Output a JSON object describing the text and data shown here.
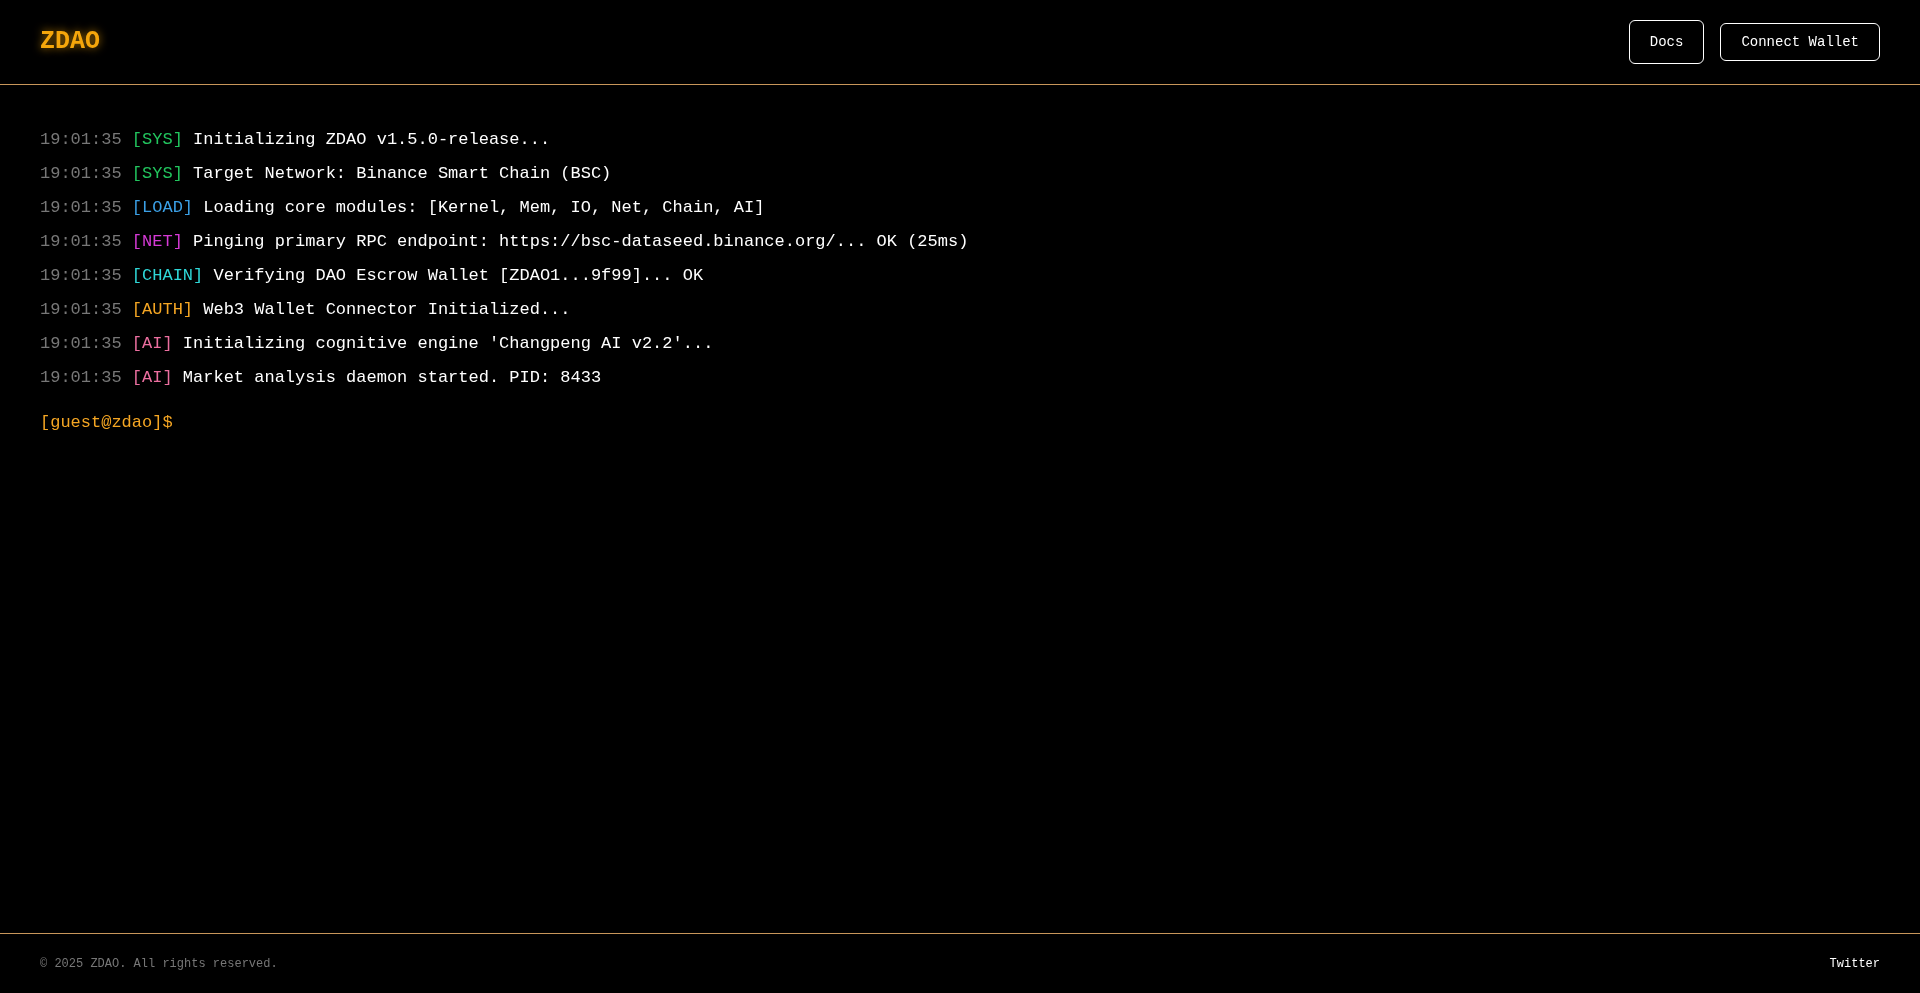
{
  "header": {
    "logo": "ZDAO",
    "buttons": [
      "Docs",
      "Connect Wallet"
    ]
  },
  "log": [
    {
      "time": "19:01:35",
      "tag": "[SYS]",
      "color": "#22c55e",
      "message": "Initializing ZDAO v1.5.0-release..."
    },
    {
      "time": "19:01:35",
      "tag": "[SYS]",
      "color": "#22c55e",
      "message": "Target Network: Binance Smart Chain (BSC)"
    },
    {
      "time": "19:01:35",
      "tag": "[LOAD]",
      "color": "#3ba0e6",
      "message": "Loading core modules: [Kernel, Mem, IO, Net, Chain, AI]"
    },
    {
      "time": "19:01:35",
      "tag": "[NET]",
      "color": "#d63ad6",
      "message": "Pinging primary RPC endpoint: https://bsc-dataseed.binance.org/... OK (25ms)"
    },
    {
      "time": "19:01:35",
      "tag": "[CHAIN]",
      "color": "#2fd8d8",
      "message": "Verifying DAO Escrow Wallet [ZDAO1...9f99]... OK"
    },
    {
      "time": "19:01:35",
      "tag": "[AUTH]",
      "color": "#f5a623",
      "message": "Web3 Wallet Connector Initialized..."
    },
    {
      "time": "19:01:35",
      "tag": "[AI]",
      "color": "#ec6fa0",
      "message": "Initializing cognitive engine 'Changpeng AI v2.2'..."
    },
    {
      "time": "19:01:35",
      "tag": "[AI]",
      "color": "#ec6fa0",
      "message": "Market analysis daemon started. PID: 8433"
    }
  ],
  "prompt": "[guest@zdao]$",
  "footer": {
    "copyright": "© 2025 ZDAO. All rights reserved.",
    "link": "Twitter"
  }
}
